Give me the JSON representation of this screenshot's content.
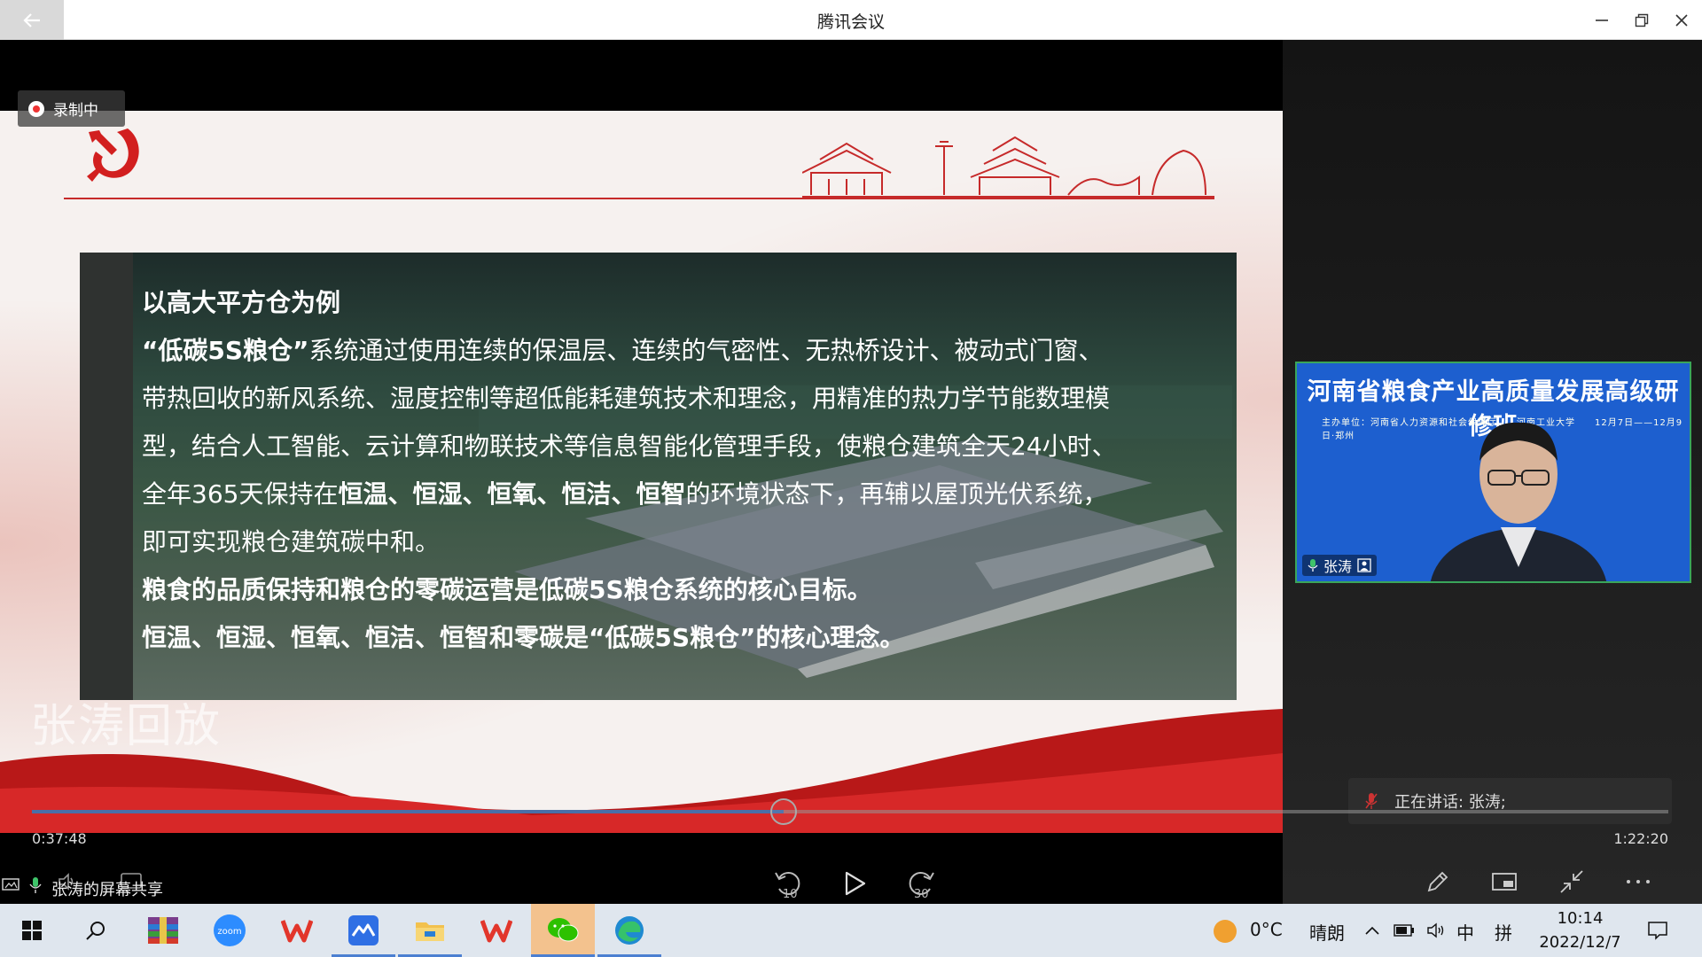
{
  "window": {
    "title": "腾讯会议"
  },
  "recording": {
    "label": "录制中"
  },
  "slide": {
    "lines": [
      {
        "parts": [
          {
            "text": "以高大平方仓为例",
            "bold": true
          }
        ]
      },
      {
        "parts": [
          {
            "text": " “低碳5S粮仓”",
            "bold": true
          },
          {
            "text": "系统通过使用连续的保温层、连续的气密性、无热桥设计、被动式门窗、",
            "bold": false
          }
        ]
      },
      {
        "parts": [
          {
            "text": "带热回收的新风系统、湿度控制等超低能耗建筑技术和理念，用精准的热力学节能数理模",
            "bold": false
          }
        ]
      },
      {
        "parts": [
          {
            "text": "型，结合人工智能、云计算和物联技术等信息智能化管理手段，使粮仓建筑全天24小时、",
            "bold": false
          }
        ]
      },
      {
        "parts": [
          {
            "text": "全年365天保持在",
            "bold": false
          },
          {
            "text": "恒温、恒湿、恒氧、恒洁、恒智",
            "bold": true
          },
          {
            "text": "的环境状态下，再辅以屋顶光伏系统，",
            "bold": false
          }
        ]
      },
      {
        "parts": [
          {
            "text": "即可实现粮仓建筑碳中和。",
            "bold": false
          }
        ]
      },
      {
        "parts": [
          {
            "text": "粮食的品质保持和粮仓的零碳运营是低碳5S粮仓系统的核心目标。",
            "bold": true
          }
        ]
      },
      {
        "parts": [
          {
            "text": "恒温、恒湿、恒氧、恒洁、恒智和零碳是“低碳5S粮仓”的核心理念。",
            "bold": true
          }
        ]
      }
    ]
  },
  "replay": {
    "label": "张涛回放"
  },
  "playback": {
    "current_time": "0:37:48",
    "total_time": "1:22:20",
    "progress": 0.4593,
    "rewind_label": "10",
    "forward_label": "30"
  },
  "share": {
    "label": "张涛的屏幕共享"
  },
  "video_tile": {
    "banner": "河南省粮食产业高质量发展高级研修班",
    "subtitle": "主办单位：河南省人力资源和社会保障厅　　河南工业大学　　12月7日——12月9日·郑州",
    "name": "张涛"
  },
  "speaking": {
    "label": "正在讲话: 张涛;"
  },
  "taskbar": {
    "weather_temp": "0°C",
    "weather_desc": "晴朗",
    "ime_lang": "中",
    "ime_mode": "拼",
    "time": "10:14",
    "date": "2022/12/7",
    "zoom_label": "zoom"
  },
  "colors": {
    "accent_red": "#c62a2a",
    "speaking_green": "#3aa55a",
    "progress_blue": "#4a6fa8",
    "taskbar_bg": "#dfe6ee"
  }
}
